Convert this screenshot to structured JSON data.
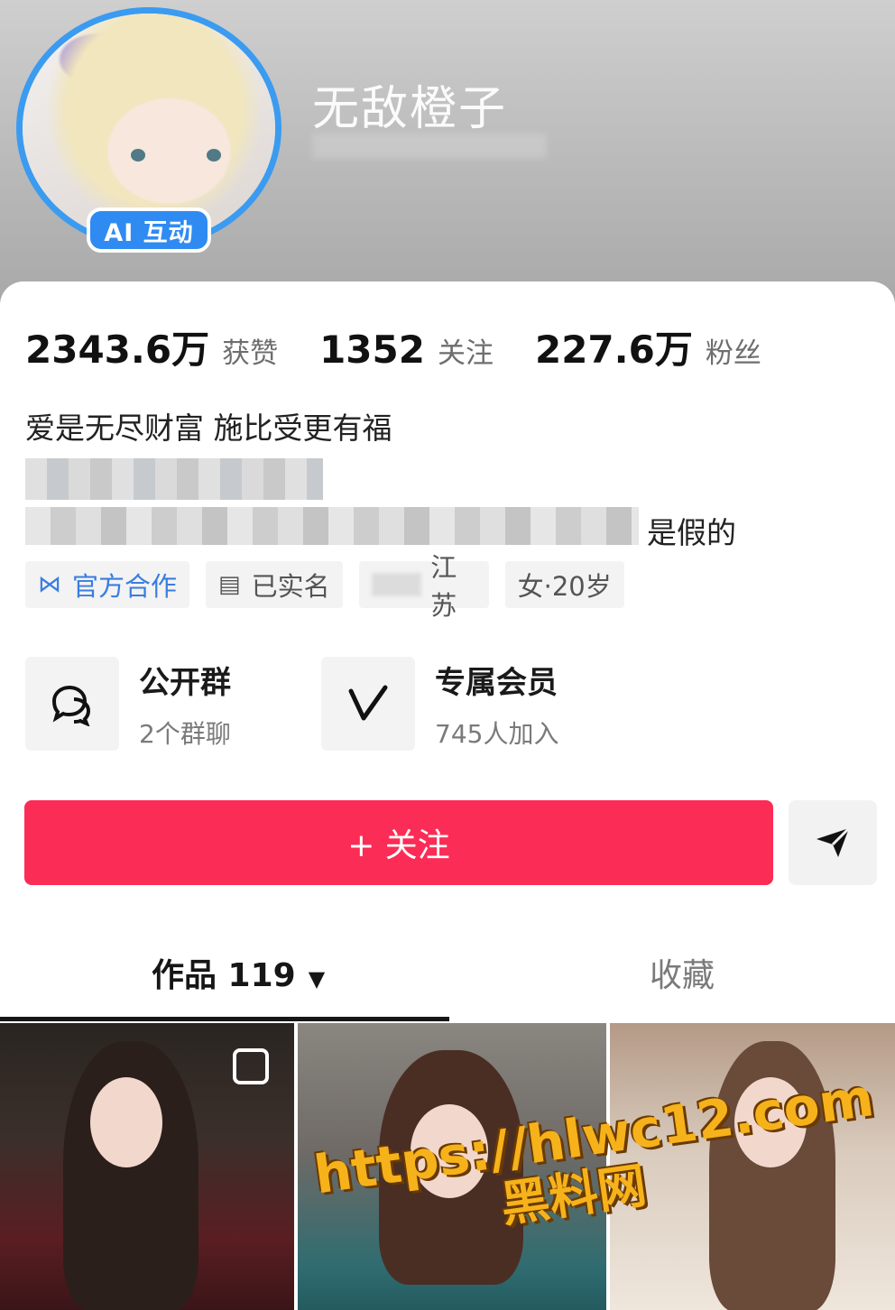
{
  "header": {
    "nickname": "无敌橙子",
    "avatar_badge": "AI 互动"
  },
  "stats": [
    {
      "value": "2343.6万",
      "label": "获赞"
    },
    {
      "value": "1352",
      "label": "关注"
    },
    {
      "value": "227.6万",
      "label": "粉丝"
    }
  ],
  "bio": {
    "line1": "爱是无尽财富 施比受更有福",
    "line3_visible_tail": "是假的"
  },
  "tags": {
    "official": "官方合作",
    "verified": "已实名",
    "location": "江苏",
    "gender_age": "女·20岁"
  },
  "groups": [
    {
      "title": "公开群",
      "subtitle": "2个群聊",
      "icon": "chat-bubbles-icon"
    },
    {
      "title": "专属会员",
      "subtitle": "745人加入",
      "icon": "v-member-icon"
    }
  ],
  "actions": {
    "follow_label": "+ 关注",
    "share_icon": "send-icon"
  },
  "tabs": {
    "works_label": "作品 119",
    "favorites_label": "收藏"
  },
  "watermark": {
    "url": "https://hlwc12.com",
    "name": "黑料网"
  },
  "colors": {
    "follow_button": "#fb2c55",
    "ai_badge": "#2f8bf2",
    "avatar_ring": "#3b9bf0",
    "official_tag": "#3a7de0",
    "watermark": "#f6b21a"
  }
}
